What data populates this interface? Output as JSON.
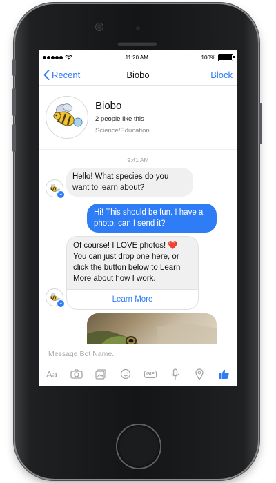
{
  "status_bar": {
    "carrier_dots": 5,
    "time": "11:20 AM",
    "battery_text": "100%",
    "battery_level": 1.0
  },
  "nav": {
    "back_label": "Recent",
    "title": "Biobo",
    "block_label": "Block"
  },
  "profile": {
    "name": "Biobo",
    "likes": "2 people like this",
    "category": "Science/Education"
  },
  "chat": {
    "timestamp": "9:41 AM",
    "messages": [
      {
        "sender": "bot",
        "text": "Hello! What species do you want to learn about?"
      },
      {
        "sender": "user",
        "text": "Hi! This should be fun. I have a photo, can I send it?"
      },
      {
        "sender": "bot",
        "text": "Of course! I LOVE photos! ❤️ You can just drop one here, or click the button below to Learn More about how I work.",
        "button": "Learn More"
      },
      {
        "sender": "user",
        "type": "photo"
      }
    ]
  },
  "composer": {
    "placeholder": "Message Bot Name...",
    "toolbar_icons": [
      "text-format-icon",
      "camera-icon",
      "gallery-icon",
      "emoji-icon",
      "gif-icon",
      "microphone-icon",
      "location-icon",
      "like-icon"
    ]
  },
  "colors": {
    "accent": "#2e7cf6",
    "incoming_bubble": "#f1f0f0",
    "phone_body": "#1a1b1d"
  }
}
